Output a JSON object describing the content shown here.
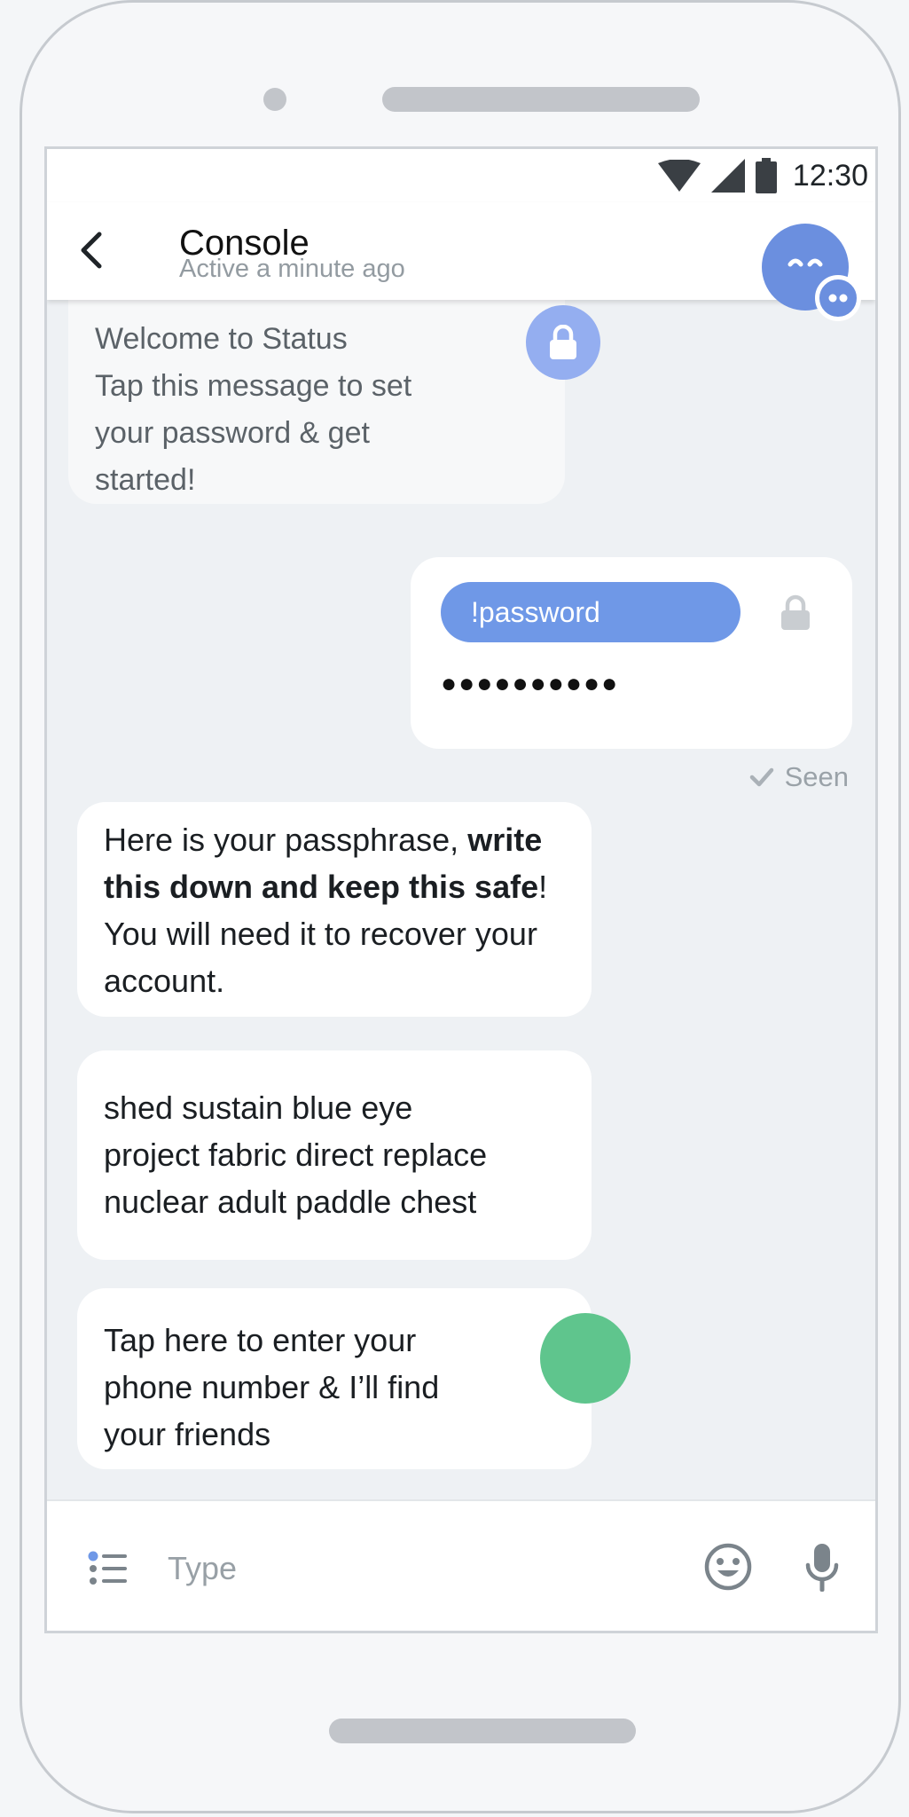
{
  "status_bar": {
    "time": "12:30"
  },
  "header": {
    "title": "Console",
    "subtitle": "Active a minute ago"
  },
  "messages": {
    "welcome": {
      "lines": [
        "Welcome to Status",
        "Tap this message to set",
        "your password & get",
        "started!"
      ]
    },
    "password": {
      "command": "!password",
      "masked_value": "●●●●●●●●●●",
      "status": "Seen"
    },
    "passphrase": {
      "text_before": "Here is your passphrase, ",
      "bold": "write this down and keep this safe",
      "text_after": "! You will need it to recover your account."
    },
    "words": {
      "lines": [
        "shed sustain blue eye",
        "project fabric direct replace",
        "nuclear adult paddle chest"
      ]
    },
    "phone": {
      "lines": [
        "Tap here to enter your",
        "phone number & I’ll find",
        "your friends"
      ]
    }
  },
  "input": {
    "placeholder": "Type"
  },
  "colors": {
    "accent": "#6f98e7",
    "avatar": "#6b8fdf",
    "green": "#5fc58d",
    "background": "#eef1f4"
  }
}
